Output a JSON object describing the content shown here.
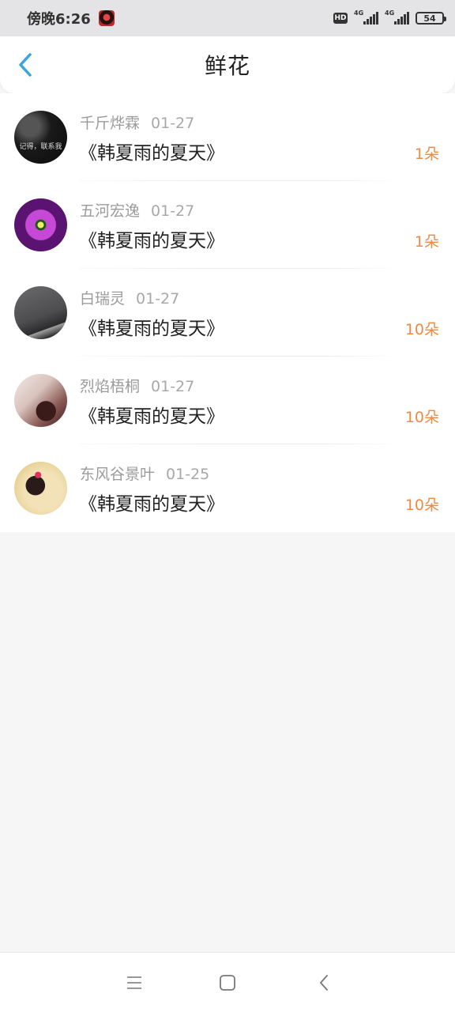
{
  "status_bar": {
    "time": "傍晚6:26",
    "hd_label": "HD",
    "network_1": "4G",
    "network_2": "4G",
    "battery": "54"
  },
  "header": {
    "title": "鲜花"
  },
  "gifts": [
    {
      "user": "千斤烨霖",
      "date": "01-27",
      "book": "《韩夏雨的夏天》",
      "amount": "1朵",
      "avatar_text": "记得，联系我"
    },
    {
      "user": "五河宏逸",
      "date": "01-27",
      "book": "《韩夏雨的夏天》",
      "amount": "1朵"
    },
    {
      "user": "白瑞灵",
      "date": "01-27",
      "book": "《韩夏雨的夏天》",
      "amount": "10朵"
    },
    {
      "user": "烈焰梧桐",
      "date": "01-27",
      "book": "《韩夏雨的夏天》",
      "amount": "10朵"
    },
    {
      "user": "东风谷景叶",
      "date": "01-25",
      "book": "《韩夏雨的夏天》",
      "amount": "10朵"
    }
  ],
  "colors": {
    "accent_blue": "#3aa3e0",
    "amount_orange": "#ef8a44"
  }
}
